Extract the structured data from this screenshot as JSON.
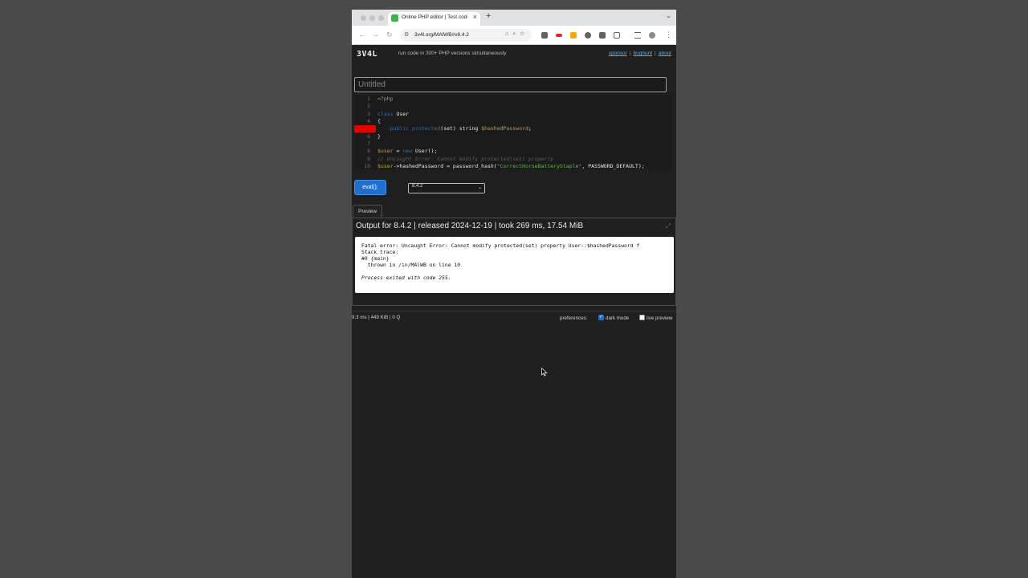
{
  "browser": {
    "tab_title": "Online PHP editor | Test code",
    "tab_close": "×",
    "new_tab": "+",
    "tab_menu": "⌄",
    "url": "3v4l.org/MAlWB#v8.4.2",
    "nav": {
      "back": "←",
      "forward": "→",
      "reload": "↻"
    }
  },
  "site": {
    "logo": "3V4L",
    "tagline": "run code in 300+ PHP versions simultaneously",
    "links": [
      "sponsor",
      "bughunt",
      "about"
    ],
    "link_separator": "|",
    "title_placeholder": "Untitled"
  },
  "editor": {
    "line_numbers": [
      "1",
      "2",
      "3",
      "4",
      "5",
      "6",
      "7",
      "8",
      "9",
      "10"
    ],
    "error_line": 5,
    "lines": [
      [
        {
          "t": "tag",
          "v": "<?php"
        }
      ],
      [],
      [
        {
          "t": "kw",
          "v": "class "
        },
        {
          "t": "plain",
          "v": "User"
        }
      ],
      [
        {
          "t": "plain",
          "v": "{"
        }
      ],
      [
        {
          "t": "plain",
          "v": "    "
        },
        {
          "t": "kw",
          "v": "public protected"
        },
        {
          "t": "plain",
          "v": "(set) string "
        },
        {
          "t": "var",
          "v": "$hashedPassword"
        },
        {
          "t": "plain",
          "v": ";"
        }
      ],
      [
        {
          "t": "plain",
          "v": "}"
        }
      ],
      [],
      [
        {
          "t": "var",
          "v": "$user"
        },
        {
          "t": "plain",
          "v": " = "
        },
        {
          "t": "kw",
          "v": "new "
        },
        {
          "t": "plain",
          "v": "User();"
        }
      ],
      [
        {
          "t": "cmt",
          "v": "// Uncaught Error: Cannot modify protected(set) property"
        }
      ],
      [
        {
          "t": "var",
          "v": "$user"
        },
        {
          "t": "plain",
          "v": "->hashedPassword = password_hash("
        },
        {
          "t": "str",
          "v": "\"CorrectHorseBatteryStaple\""
        },
        {
          "t": "plain",
          "v": ", PASSWORD_DEFAULT);"
        }
      ]
    ]
  },
  "controls": {
    "eval_label": "eval();",
    "version_selected": "8.4.2",
    "select_arrow": "⌄"
  },
  "preview": {
    "tab_label": "Preview",
    "header": "Output for 8.4.2 | released 2024-12-19 | took 269 ms, 17.54 MiB",
    "expand_icon": "⤢",
    "output_lines": [
      "Fatal error: Uncaught Error: Cannot modify protected(set) property User::$hashedPassword f",
      "Stack trace:",
      "#0 {main}",
      "  thrown in /in/MAlWB on line 10"
    ],
    "exit_line": "Process exited with code 255.",
    "scroll_position": 0.73
  },
  "footer": {
    "stats": "9.3 ms | 449 KiB | 0 Q",
    "preferences_label": "preferences:",
    "dark_mode_label": "dark mode",
    "dark_mode_checked": true,
    "live_preview_label": "live preview",
    "live_preview_checked": false
  },
  "colors": {
    "accent": "#1f6fd0",
    "link": "#4fb3ff",
    "error_marker": "#e50000",
    "favicon": "#3bb54a"
  }
}
